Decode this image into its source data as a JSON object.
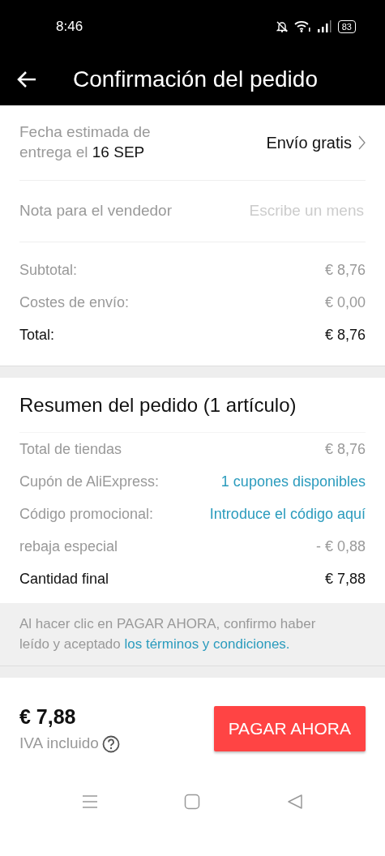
{
  "status_bar": {
    "time": "8:46",
    "battery": "83"
  },
  "header": {
    "title": "Confirmación del pedido"
  },
  "delivery": {
    "label": "Fecha estimada de entrega el",
    "date": "16 SEP",
    "shipping": "Envío gratis"
  },
  "seller_note": {
    "label": "Nota para el vendedor",
    "placeholder": "Escribe un mens"
  },
  "totals": [
    {
      "kind": "muted",
      "label": "Subtotal:",
      "value": "€ 8,76"
    },
    {
      "kind": "muted",
      "label": "Costes de envío:",
      "value": "€ 0,00"
    },
    {
      "kind": "total",
      "label": "Total:",
      "value": "€ 8,76"
    }
  ],
  "summary": {
    "title": "Resumen del pedido (1 artículo)",
    "rows": [
      {
        "kind": "muted",
        "label": "Total de tiendas",
        "value": "€ 8,76"
      },
      {
        "kind": "link",
        "label": "Cupón de AliExpress:",
        "value": "1 cupones disponibles"
      },
      {
        "kind": "link",
        "label": "Código promocional:",
        "value": "Introduce el código aquí"
      },
      {
        "kind": "muted",
        "label": "rebaja especial",
        "value": "- € 0,88"
      },
      {
        "kind": "total",
        "label": "Cantidad final",
        "value": "€ 7,88"
      }
    ]
  },
  "terms": {
    "text": "Al hacer clic en PAGAR AHORA, confirmo haber leído y aceptado",
    "link": "los términos y condiciones."
  },
  "footer": {
    "price": "€ 7,88",
    "tax_note": "IVA incluido",
    "button": "PAGAR AHORA"
  }
}
